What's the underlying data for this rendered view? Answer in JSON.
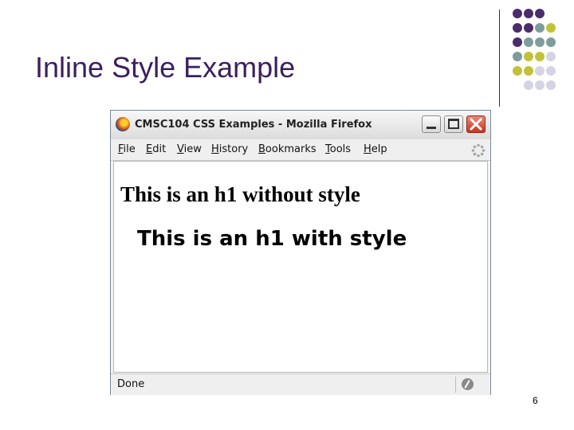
{
  "slide": {
    "title": "Inline Style Example",
    "page_number": "6"
  },
  "window": {
    "title": "CMSC104 CSS Examples - Mozilla Firefox",
    "menu": [
      {
        "label": "File"
      },
      {
        "label": "Edit"
      },
      {
        "label": "View"
      },
      {
        "label": "History"
      },
      {
        "label": "Bookmarks"
      },
      {
        "label": "Tools"
      },
      {
        "label": "Help"
      }
    ]
  },
  "content": {
    "h1_plain": "This is an h1 without style",
    "h1_styled": "This is an h1 with style"
  },
  "status": {
    "text": "Done"
  },
  "colors": {
    "title": "#3b1f5e",
    "dot_purple": "#4a2d6b",
    "dot_teal": "#7f9c9c",
    "dot_olive": "#c2c23a",
    "dot_lavender": "#d4d4e4"
  }
}
